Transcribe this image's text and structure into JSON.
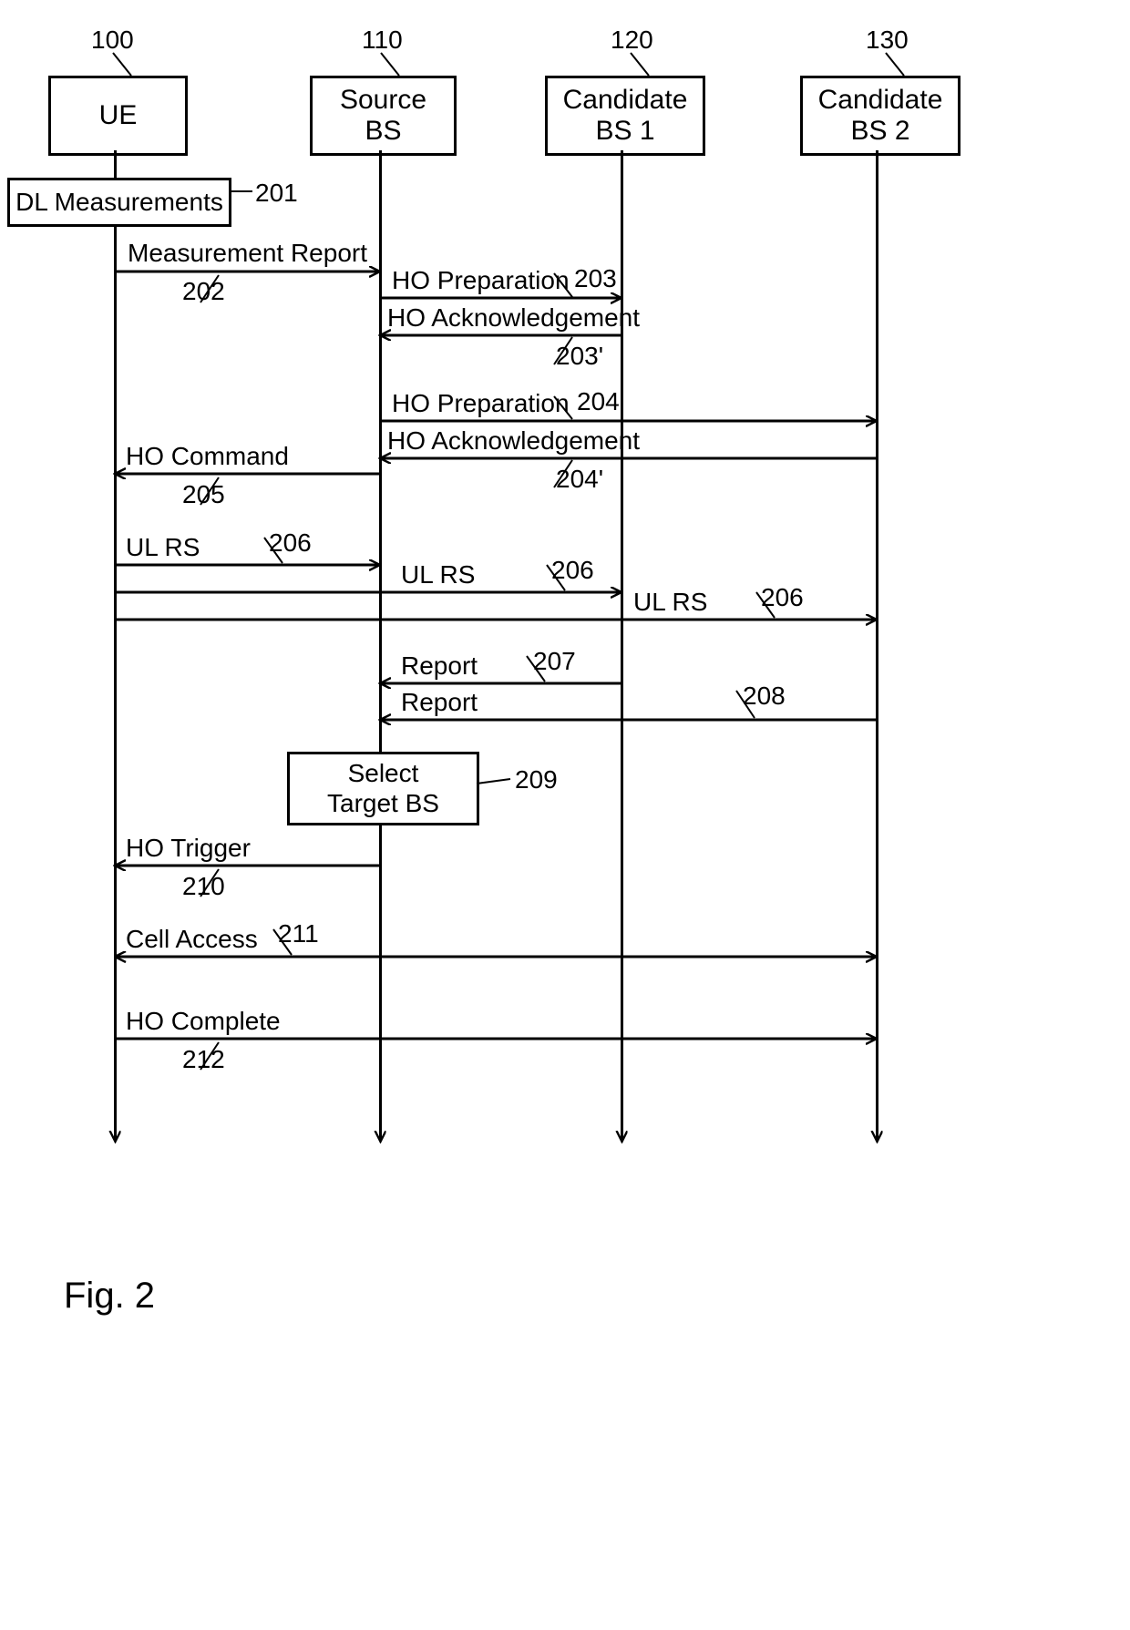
{
  "figure": {
    "caption": "Fig. 2"
  },
  "actors": {
    "ue": {
      "label": "UE",
      "num": "100"
    },
    "src": {
      "label": "Source\nBS",
      "num": "110"
    },
    "c1": {
      "label": "Candidate\nBS 1",
      "num": "120"
    },
    "c2": {
      "label": "Candidate\nBS 2",
      "num": "130"
    }
  },
  "boxes": {
    "dlmeas": {
      "label": "DL Measurements",
      "num": "201"
    },
    "select": {
      "label": "Select\nTarget BS",
      "num": "209"
    }
  },
  "messages": {
    "m202": {
      "text": "Measurement Report",
      "num": "202"
    },
    "m203": {
      "text": "HO Preparation",
      "num": "203"
    },
    "m203a": {
      "text": "HO Acknowledgement",
      "num": "203'"
    },
    "m204": {
      "text": "HO Preparation",
      "num": "204"
    },
    "m204a": {
      "text": "HO Acknowledgement",
      "num": "204'"
    },
    "m205": {
      "text": "HO Command",
      "num": "205"
    },
    "m206a": {
      "text": "UL RS",
      "num": "206"
    },
    "m206b": {
      "text": "UL RS",
      "num": "206"
    },
    "m206c": {
      "text": "UL RS",
      "num": "206"
    },
    "m207": {
      "text": "Report",
      "num": "207"
    },
    "m208": {
      "text": "Report",
      "num": "208"
    },
    "m210": {
      "text": "HO Trigger",
      "num": "210"
    },
    "m211": {
      "text": "Cell Access",
      "num": "211"
    },
    "m212": {
      "text": "HO Complete",
      "num": "212"
    }
  },
  "chart_data": {
    "type": "sequence_diagram",
    "title": "Fig. 2",
    "participants": [
      {
        "id": "UE",
        "label": "UE",
        "num": 100
      },
      {
        "id": "SRC",
        "label": "Source BS",
        "num": 110
      },
      {
        "id": "C1",
        "label": "Candidate BS 1",
        "num": 120
      },
      {
        "id": "C2",
        "label": "Candidate BS 2",
        "num": 130
      }
    ],
    "steps": [
      {
        "num": 201,
        "at": "UE",
        "type": "process",
        "label": "DL Measurements"
      },
      {
        "num": 202,
        "from": "UE",
        "to": "SRC",
        "label": "Measurement Report"
      },
      {
        "num": 203,
        "from": "SRC",
        "to": "C1",
        "label": "HO Preparation"
      },
      {
        "num": "203'",
        "from": "C1",
        "to": "SRC",
        "label": "HO Acknowledgement"
      },
      {
        "num": 204,
        "from": "SRC",
        "to": "C2",
        "label": "HO Preparation"
      },
      {
        "num": "204'",
        "from": "C2",
        "to": "SRC",
        "label": "HO Acknowledgement"
      },
      {
        "num": 205,
        "from": "SRC",
        "to": "UE",
        "label": "HO Command"
      },
      {
        "num": 206,
        "from": "UE",
        "to": "SRC",
        "label": "UL RS"
      },
      {
        "num": 206,
        "from": "UE",
        "to": "C1",
        "label": "UL RS"
      },
      {
        "num": 206,
        "from": "UE",
        "to": "C2",
        "label": "UL RS"
      },
      {
        "num": 207,
        "from": "C1",
        "to": "SRC",
        "label": "Report"
      },
      {
        "num": 208,
        "from": "C2",
        "to": "SRC",
        "label": "Report"
      },
      {
        "num": 209,
        "at": "SRC",
        "type": "process",
        "label": "Select Target BS"
      },
      {
        "num": 210,
        "from": "SRC",
        "to": "UE",
        "label": "HO Trigger"
      },
      {
        "num": 211,
        "from": "UE",
        "to": "C2",
        "label": "Cell Access",
        "bidir": true
      },
      {
        "num": 212,
        "from": "UE",
        "to": "C2",
        "label": "HO Complete"
      }
    ]
  }
}
